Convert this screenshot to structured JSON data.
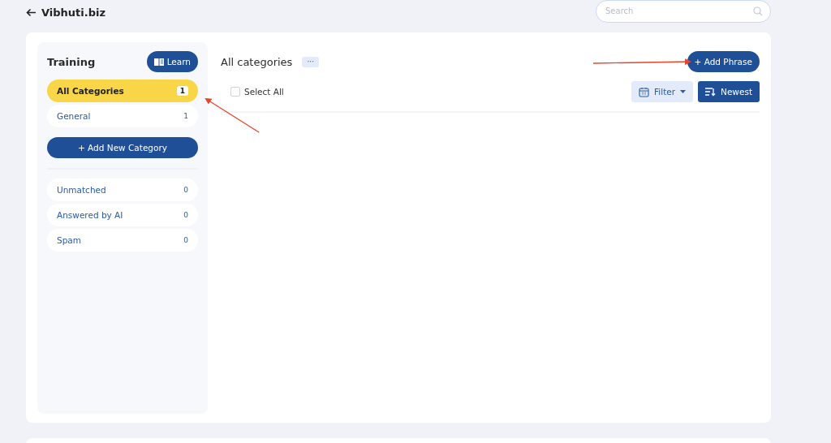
{
  "header": {
    "title": "Vibhuti.biz",
    "search": {
      "placeholder": "Search"
    }
  },
  "sidebar": {
    "title": "Training",
    "learn_button": "Learn",
    "categories": [
      {
        "label": "All Categories",
        "count": "1",
        "selected": true
      },
      {
        "label": "General",
        "count": "1",
        "selected": false
      }
    ],
    "add_button": "+ Add New Category",
    "special": [
      {
        "label": "Unmatched",
        "count": "0",
        "selected": false
      },
      {
        "label": "Answered by AI",
        "count": "0",
        "selected": false
      },
      {
        "label": "Spam",
        "count": "0",
        "selected": false
      }
    ]
  },
  "main": {
    "title": "All categories",
    "more_button": "···",
    "add_button": "+ Add Phrase",
    "select_all": {
      "label": "Select All",
      "checked": false
    },
    "filter_button": "Filter",
    "sort_button": "Newest"
  }
}
